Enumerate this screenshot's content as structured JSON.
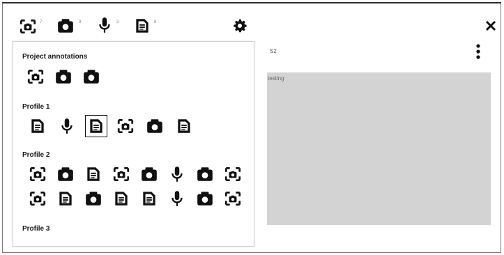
{
  "toolbar": {
    "counts": [
      {
        "icon": "camera-frame-icon",
        "count": "7"
      },
      {
        "icon": "camera-icon",
        "count": "9"
      },
      {
        "icon": "microphone-icon",
        "count": "3"
      },
      {
        "icon": "document-icon",
        "count": "8"
      }
    ],
    "settings_icon": "gear-icon",
    "close_icon": "close-icon"
  },
  "sections": [
    {
      "title": "Project annotations",
      "icons": [
        "camera-frame-icon",
        "camera-icon",
        "camera-icon"
      ]
    },
    {
      "title": "Profile 1",
      "icons": [
        "document-icon",
        "microphone-icon",
        "document-icon",
        "camera-frame-icon",
        "camera-icon",
        "document-icon"
      ],
      "selected_index": 2
    },
    {
      "title": "Profile 2",
      "rows": [
        [
          "camera-frame-icon",
          "camera-icon",
          "document-icon",
          "camera-frame-icon",
          "camera-icon",
          "microphone-icon",
          "camera-icon",
          "camera-frame-icon"
        ],
        [
          "camera-frame-icon",
          "document-icon",
          "camera-icon",
          "document-icon",
          "document-icon",
          "microphone-icon",
          "camera-icon",
          "camera-frame-icon"
        ]
      ]
    },
    {
      "title": "Profile 3",
      "icons": []
    }
  ],
  "detail": {
    "label": "S2",
    "menu_icon": "more-vertical-icon",
    "preview_text": "testing",
    "preview_color": "#d3d3d3"
  }
}
